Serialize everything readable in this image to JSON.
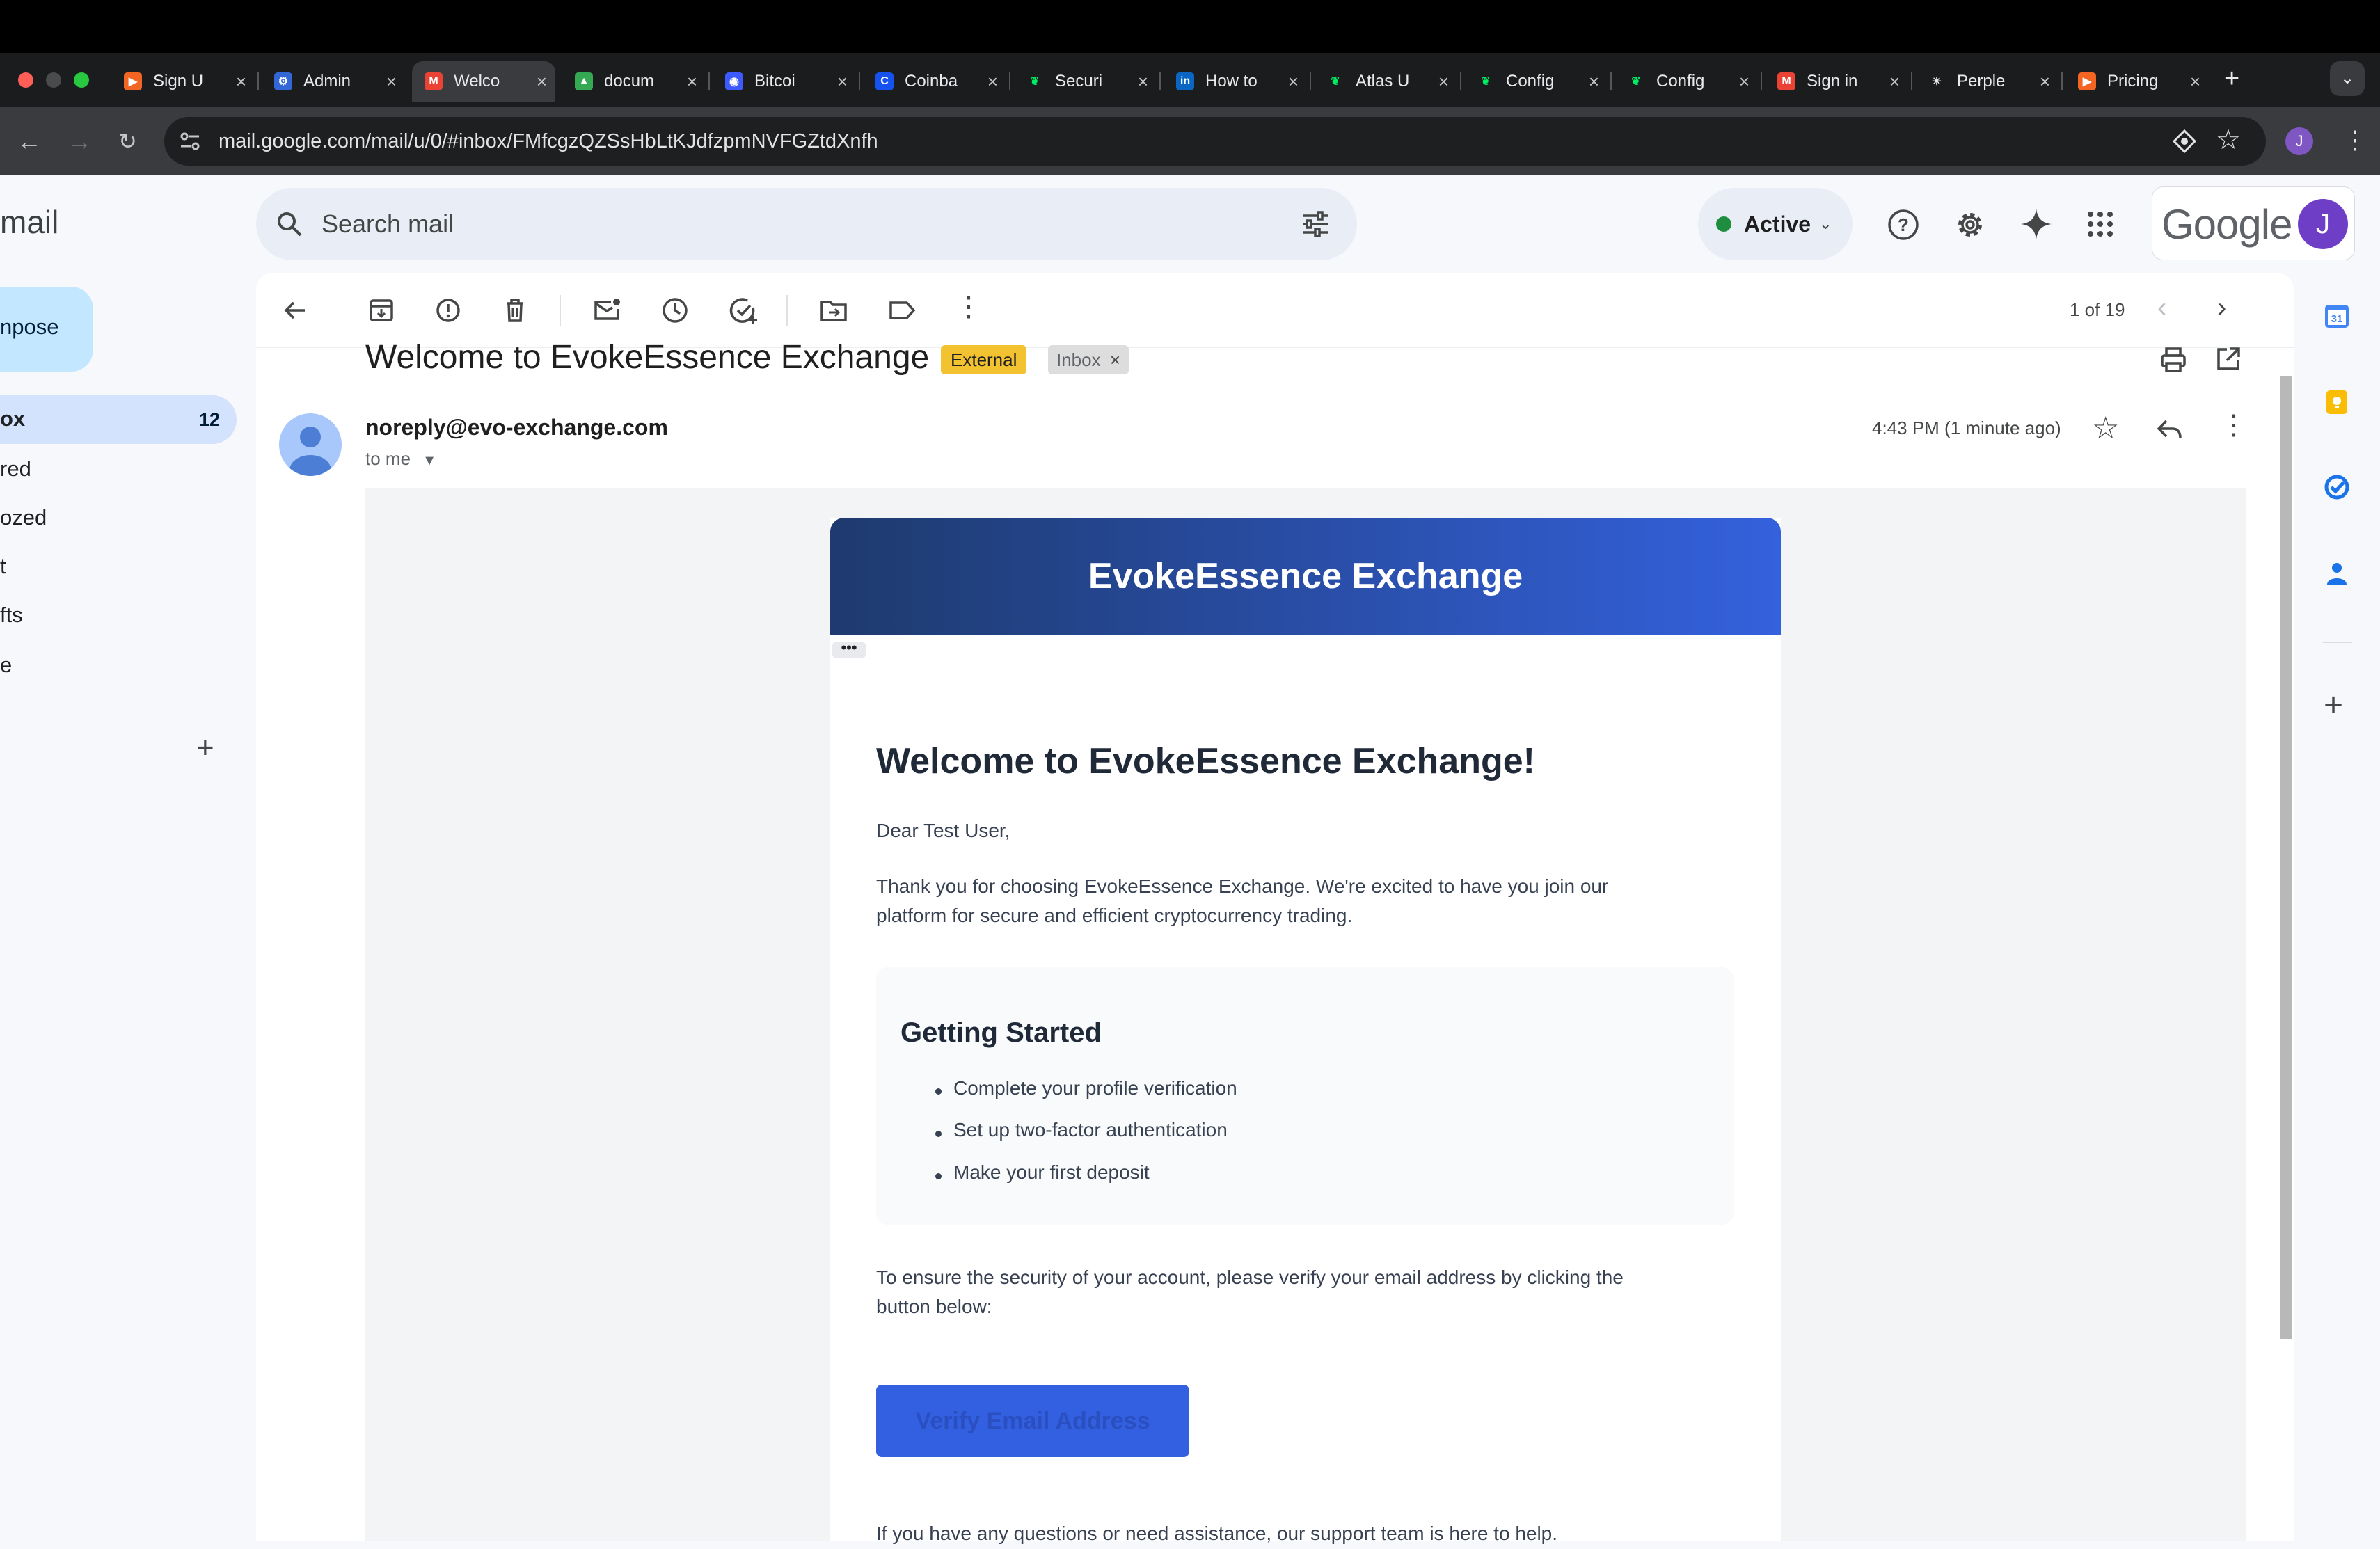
{
  "browser": {
    "tabs": [
      {
        "title": "Sign U",
        "favicon_color": "#f26522",
        "favicon": "arrow-icon"
      },
      {
        "title": "Admin",
        "favicon_color": "#3367d6",
        "favicon": "gear-icon"
      },
      {
        "title": "Welco",
        "favicon_color": "#ea4335",
        "favicon": "gmail-icon",
        "active": true
      },
      {
        "title": "docum",
        "favicon_color": "#34a853",
        "favicon": "drive-icon"
      },
      {
        "title": "Bitcoi",
        "favicon_color": "#3d5afe",
        "favicon": "chart-icon"
      },
      {
        "title": "Coinba",
        "favicon_color": "#1652f0",
        "favicon": "coinbase-icon"
      },
      {
        "title": "Securi",
        "favicon_color": "#00ed64",
        "favicon": "leaf-icon"
      },
      {
        "title": "How to",
        "favicon_color": "#0a66c2",
        "favicon": "linkedin-icon"
      },
      {
        "title": "Atlas U",
        "favicon_color": "#00ed64",
        "favicon": "leaf-icon"
      },
      {
        "title": "Config",
        "favicon_color": "#00ed64",
        "favicon": "leaf-icon"
      },
      {
        "title": "Config",
        "favicon_color": "#00ed64",
        "favicon": "leaf-icon"
      },
      {
        "title": "Sign in",
        "favicon_color": "#ea4335",
        "favicon": "gmail-icon"
      },
      {
        "title": "Perple",
        "favicon_color": "#ffffff",
        "favicon": "perplexity-icon"
      },
      {
        "title": "Pricing",
        "favicon_color": "#f26522",
        "favicon": "arrow-icon"
      }
    ],
    "url": "mail.google.com/mail/u/0/#inbox/FMfcgzQZSsHbLtKJdfzpmNVFGZtdXnfh",
    "profile_initial": "J"
  },
  "gmail": {
    "logo": "mail",
    "search_placeholder": "Search mail",
    "status": "Active",
    "account_brand": "Google",
    "account_initial": "J",
    "compose": "npose",
    "nav": [
      {
        "label": "ox",
        "count": "12",
        "selected": true
      },
      {
        "label": "red"
      },
      {
        "label": "ozed"
      },
      {
        "label": "t"
      },
      {
        "label": "fts"
      },
      {
        "label": "e"
      }
    ],
    "pager": "1 of 19"
  },
  "message": {
    "subject": "Welcome to EvokeEssence Exchange",
    "label_external": "External",
    "label_inbox": "Inbox",
    "label_inbox_remove": "×",
    "sender": "noreply@evo-exchange.com",
    "recipient": "to me",
    "time": "4:43 PM (1 minute ago)"
  },
  "email": {
    "banner_title": "EvokeEssence Exchange",
    "trimmed": "•••",
    "heading": "Welcome to EvokeEssence Exchange!",
    "greeting": "Dear Test User,",
    "intro_line1": "Thank you for choosing EvokeEssence Exchange. We're excited to have you join our",
    "intro_line2": "platform for secure and efficient cryptocurrency trading.",
    "getting_started_title": "Getting Started",
    "steps": [
      "Complete your profile verification",
      "Set up two-factor authentication",
      "Make your first deposit"
    ],
    "security_line1": "To ensure the security of your account, please verify your email address by clicking the",
    "security_line2": "button below:",
    "verify_button": "Verify Email Address",
    "footer_line": "If you have any questions or need assistance, our support team is here to help."
  },
  "colors": {
    "accent": "#3461dd",
    "banner_dark": "#1e3a6e",
    "external_chip": "#f2c230"
  }
}
